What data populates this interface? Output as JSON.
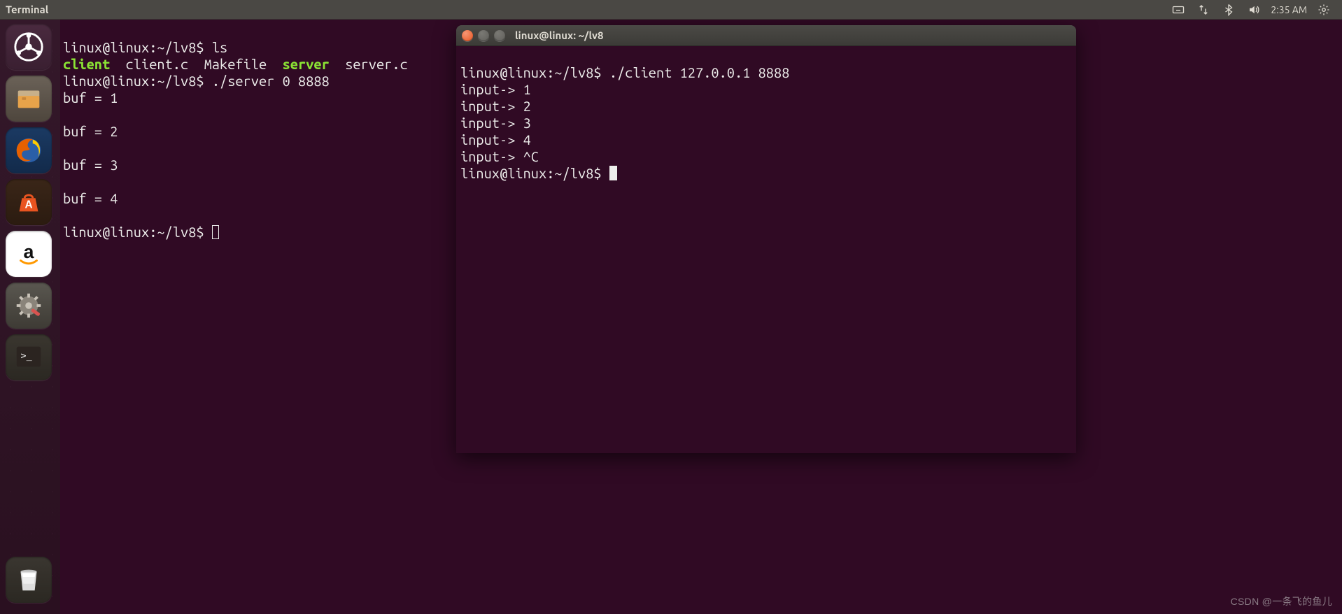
{
  "menubar": {
    "title": "Terminal",
    "time": "2:35 AM"
  },
  "launcher_items": [
    "dash",
    "files",
    "firefox",
    "software",
    "amazon",
    "settings",
    "terminal"
  ],
  "terminal1": {
    "l1_prompt": "linux@linux:~/lv8$ ",
    "l1_cmd": "ls",
    "l2_client": "client",
    "l2_clientc": "  client.c  Makefile  ",
    "l2_server": "server",
    "l2_serverc": "  server.c",
    "l3_prompt": "linux@linux:~/lv8$ ",
    "l3_cmd": "./server 0 8888",
    "l4": "buf = 1",
    "l5": "",
    "l6": "buf = 2",
    "l7": "",
    "l8": "buf = 3",
    "l9": "",
    "l10": "buf = 4",
    "l11": "",
    "l12_prompt": "linux@linux:~/lv8$ "
  },
  "terminal2": {
    "title": "linux@linux: ~/lv8",
    "l1_prompt": "linux@linux:~/lv8$ ",
    "l1_cmd": "./client 127.0.0.1 8888",
    "l2": "input-> 1",
    "l3": "input-> 2",
    "l4": "input-> 3",
    "l5": "input-> 4",
    "l6": "input-> ^C",
    "l7_prompt": "linux@linux:~/lv8$ "
  },
  "watermark": "CSDN @一条飞的鱼儿"
}
